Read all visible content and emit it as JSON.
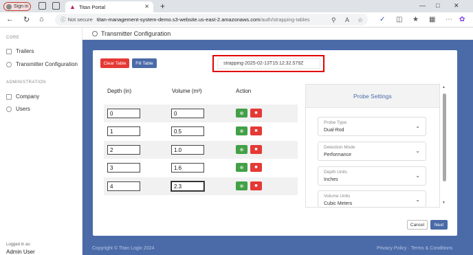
{
  "browser": {
    "signin_label": "Sign in",
    "tab_title": "Titan Portal",
    "url_not_secure": "Not secure",
    "url_host": "titan-management-system-demo.s3-website.us-east-2.amazonaws.com",
    "url_path": "/auth/strapping-tables"
  },
  "sidebar": {
    "core_heading": "CORE",
    "items": [
      {
        "label": "Trailers",
        "icon": "truck-icon"
      },
      {
        "label": "Transmitter Configuration",
        "icon": "settings-icon"
      }
    ],
    "admin_heading": "ADMINISTRATION",
    "admin_items": [
      {
        "label": "Company",
        "icon": "building-icon"
      },
      {
        "label": "Users",
        "icon": "users-icon"
      }
    ],
    "logged_in_as": "Logged in as:",
    "user": "Admin User"
  },
  "page": {
    "title": "Transmitter Configuration",
    "clear_table": "Clear Table",
    "fill_table": "Fill Table",
    "table_name": "strapping-2025-02-13T15:12:32.579Z",
    "columns": {
      "depth": "Depth (in)",
      "volume": "Volume (m³)",
      "action": "Action"
    },
    "rows": [
      {
        "depth": "0",
        "volume": "0"
      },
      {
        "depth": "1",
        "volume": "0.5"
      },
      {
        "depth": "2",
        "volume": "1.0"
      },
      {
        "depth": "3",
        "volume": "1.6"
      },
      {
        "depth": "4",
        "volume": "2.3"
      }
    ],
    "cancel": "Cancel",
    "next": "Next"
  },
  "probe_settings": {
    "title": "Probe Settings",
    "fields": [
      {
        "label": "Probe Type",
        "value": "Dual-Rod"
      },
      {
        "label": "Detection Mode",
        "value": "Performance"
      },
      {
        "label": "Depth Units",
        "value": "Inches"
      },
      {
        "label": "Volume Units",
        "value": "Cubic Meters"
      }
    ]
  },
  "footer": {
    "copyright": "Copyright © Titan Logix 2024",
    "links": "Privacy Policy · Terms & Conditions"
  },
  "colors": {
    "primary": "#4a6aa8",
    "danger": "#e53935",
    "success": "#43a047",
    "highlight": "#e00000"
  }
}
